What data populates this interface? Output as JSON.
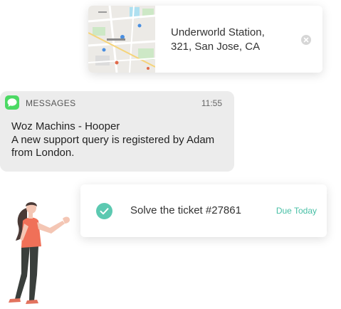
{
  "location_card": {
    "address_line1": "Underworld Station,",
    "address_line2": "321, San Jose, CA",
    "map_icon": "map-thumbnail",
    "dismiss_icon": "close-icon"
  },
  "message_notification": {
    "app_icon": "messages-bubble-icon",
    "app_name": "MESSAGES",
    "time": "11:55",
    "sender": "Woz Machins - Hooper",
    "body": "A new support query is registered by Adam from London."
  },
  "task_card": {
    "check_icon": "check-circle-icon",
    "title": "Solve the ticket #27861",
    "due": "Due Today"
  },
  "colors": {
    "accent_teal": "#47bfa5",
    "messages_green": "#4cd964",
    "notification_bg": "#ececec",
    "illustration_shirt": "#f07058"
  }
}
